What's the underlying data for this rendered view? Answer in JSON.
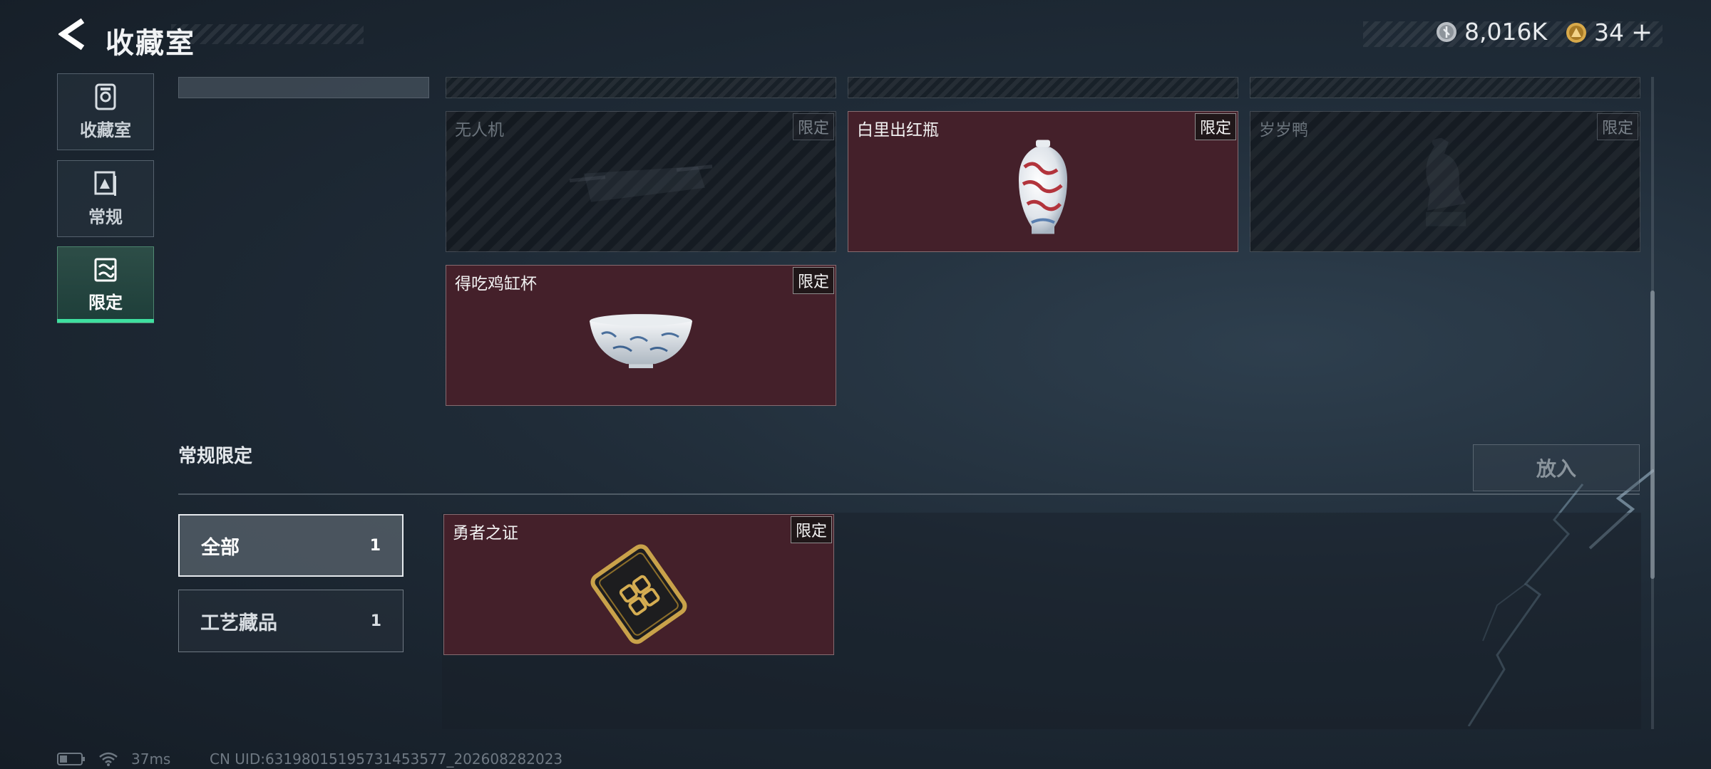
{
  "header": {
    "title": "收藏室",
    "back_icon": "back-arrow-icon",
    "silver_currency": {
      "icon": "silver-coin-icon",
      "value": "8,016K"
    },
    "gold_currency": {
      "icon": "gold-coin-icon",
      "value": "34",
      "add_label": "+"
    }
  },
  "nav": {
    "items": [
      {
        "label": "收藏室",
        "icon": "collection-icon",
        "active": false
      },
      {
        "label": "常规",
        "icon": "regular-icon",
        "active": false
      },
      {
        "label": "限定",
        "icon": "limited-icon",
        "active": true
      }
    ],
    "active_color": "#3ee0a0"
  },
  "limited_grid": {
    "cards": [
      {
        "name": "无人机",
        "tag": "限定",
        "owned": false,
        "art": "drone-art"
      },
      {
        "name": "白里出红瓶",
        "tag": "限定",
        "owned": true,
        "art": "vase-art"
      },
      {
        "name": "岁岁鸭",
        "tag": "限定",
        "owned": false,
        "art": "duck-statue-art"
      },
      {
        "name": "得吃鸡缸杯",
        "tag": "限定",
        "owned": true,
        "art": "cup-art"
      }
    ]
  },
  "regular_limited": {
    "section_title": "常规限定",
    "place_button": "放入",
    "filters": [
      {
        "label": "全部",
        "count": "1",
        "selected": true
      },
      {
        "label": "工艺藏品",
        "count": "1",
        "selected": false
      }
    ],
    "items": [
      {
        "name": "勇者之证",
        "tag": "限定",
        "owned": true,
        "art": "card-art"
      }
    ]
  },
  "status": {
    "battery_icon": "battery-icon",
    "wifi_icon": "wifi-icon",
    "ping": "37ms",
    "uid": "CN UID:631980151957314535​77_202608282023"
  },
  "colors": {
    "owned_card_bg": "#44202a",
    "accent": "#3ee0a0"
  }
}
